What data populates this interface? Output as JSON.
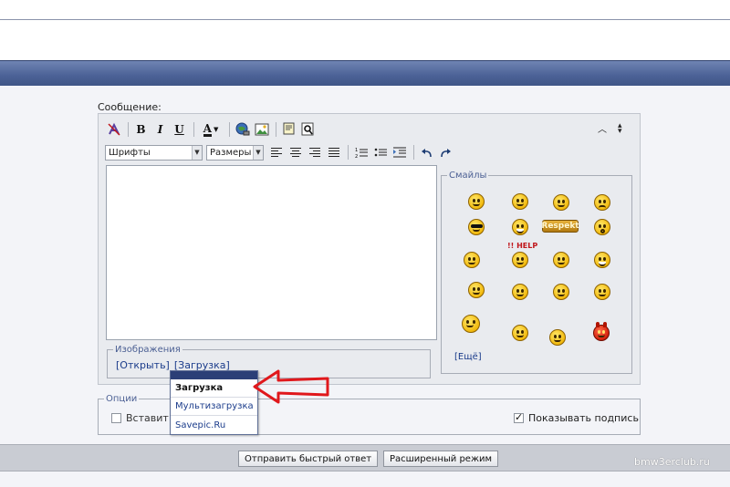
{
  "form": {
    "message_label": "Сообщение:"
  },
  "toolbar": {
    "font_select": "Шрифты",
    "size_select": "Размеры",
    "bold": "B",
    "italic": "I",
    "underline": "U",
    "color": "A"
  },
  "smilies": {
    "legend": "Смайлы",
    "more_link": "[Ещё]",
    "respekt_text": "Respekt",
    "help_text": "!! HELP"
  },
  "images": {
    "legend": "Изображения",
    "open_link": "[Открыть]",
    "upload_link": "[Загрузка]"
  },
  "dropdown": {
    "items": [
      "Загрузка",
      "Мультизагрузка",
      "Savepic.Ru"
    ]
  },
  "options": {
    "legend": "Опции",
    "left_checkbox_label": "Вставит",
    "show_signature_label": "Показывать подпись",
    "show_signature_checked": true
  },
  "buttons": {
    "quick_reply": "Отправить быстрый ответ",
    "advanced_mode": "Расширенный режим"
  },
  "watermark": "bmw3erclub.ru",
  "colors": {
    "header_bar": "#4b6196",
    "annotation_arrow": "#e0181c",
    "link": "#1b3c8b"
  }
}
